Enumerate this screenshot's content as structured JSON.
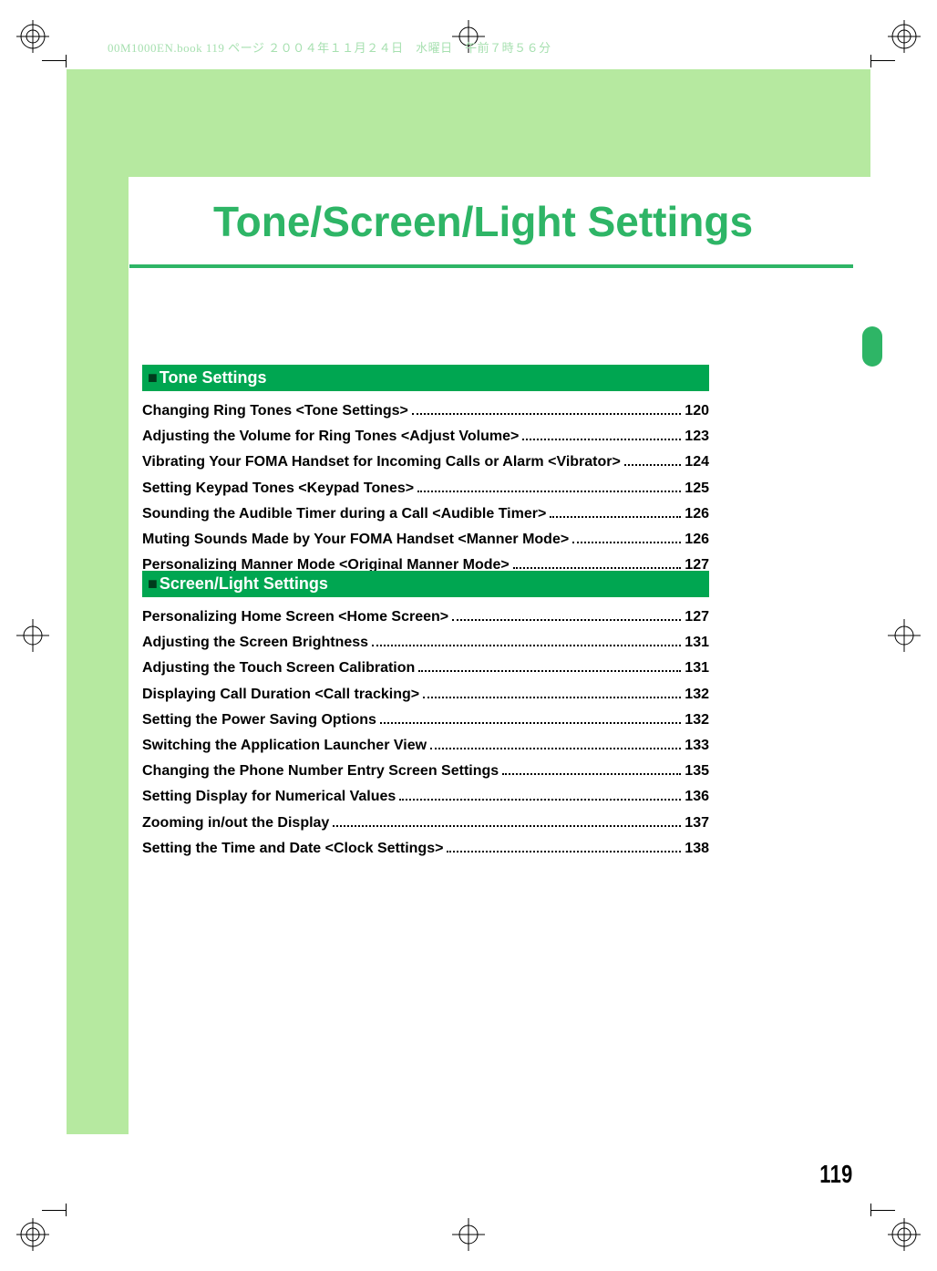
{
  "meta_header": "00M1000EN.book  119 ページ  ２００４年１１月２４日　水曜日　午前７時５６分",
  "title": "Tone/Screen/Light Settings",
  "page_number": "119",
  "sections": [
    {
      "heading": "Tone Settings",
      "items": [
        {
          "title": "Changing Ring Tones <Tone Settings>",
          "page": "120"
        },
        {
          "title": "Adjusting the Volume for Ring Tones <Adjust Volume>",
          "page": "123"
        },
        {
          "title": "Vibrating Your FOMA Handset for Incoming Calls or Alarm <Vibrator>",
          "page": "124"
        },
        {
          "title": "Setting Keypad Tones <Keypad Tones>",
          "page": "125"
        },
        {
          "title": "Sounding the Audible Timer during a Call <Audible Timer>",
          "page": "126"
        },
        {
          "title": "Muting Sounds Made by Your FOMA Handset <Manner Mode>",
          "page": "126"
        },
        {
          "title": "Personalizing Manner Mode <Original Manner Mode>",
          "page": "127"
        }
      ]
    },
    {
      "heading": "Screen/Light Settings",
      "items": [
        {
          "title": "Personalizing Home Screen <Home Screen>",
          "page": "127"
        },
        {
          "title": "Adjusting the Screen Brightness",
          "page": "131"
        },
        {
          "title": "Adjusting the Touch Screen Calibration",
          "page": "131"
        },
        {
          "title": "Displaying Call Duration <Call tracking>",
          "page": "132"
        },
        {
          "title": "Setting the Power Saving Options",
          "page": "132"
        },
        {
          "title": "Switching the Application Launcher View",
          "page": "133"
        },
        {
          "title": "Changing the Phone Number Entry Screen Settings",
          "page": "135"
        },
        {
          "title": "Setting Display for Numerical Values",
          "page": "136"
        },
        {
          "title": "Zooming in/out the Display",
          "page": "137"
        },
        {
          "title": "Setting the Time and Date <Clock Settings>",
          "page": "138"
        }
      ]
    }
  ]
}
